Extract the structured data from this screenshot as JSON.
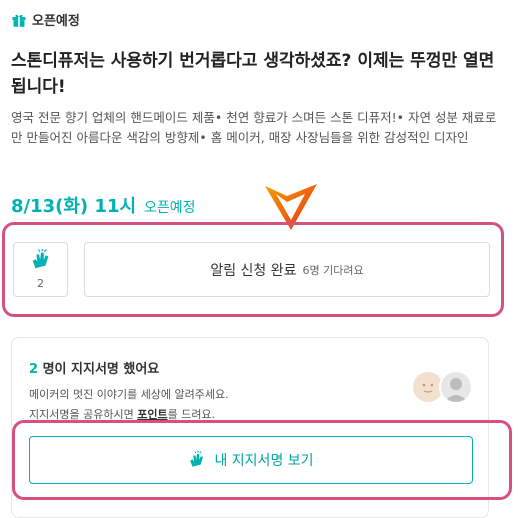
{
  "status": {
    "label": "오픈예정",
    "icon": "gift-icon"
  },
  "title": "스톤디퓨저는 사용하기 번거롭다고 생각하셨죠? 이제는 뚜껑만 열면 됩니다!",
  "description": "영국 전문 향기 업체의 핸드메이드 제품• 천연 향료가 스며든 스톤 디퓨저!• 자연 성분 재료로만 만들어진 아름다운 색감의 방향제• 홈 메이커, 매장 사장님들을 위한 감성적인 디자인",
  "open": {
    "date": "8/13(화) 11시",
    "tag": "오픈예정"
  },
  "like": {
    "count": "2",
    "icon": "clap-hands-icon"
  },
  "notify": {
    "label": "알림 신청 완료",
    "sub": "6명 기다려요"
  },
  "support": {
    "count": "2",
    "title_suffix": " 명이 지지서명 했어요",
    "line1": "메이커의 멋진 이야기를 세상에 알려주세요.",
    "line2_prefix": "지지서명을 공유하시면 ",
    "line2_point": "포인트",
    "line2_suffix": "를 드려요.",
    "button_label": "내 지지서명 보기",
    "button_icon": "clap-hands-icon"
  },
  "colors": {
    "accent": "#00b2b2",
    "highlight": "#d6527c",
    "arrow_orange": "#f5a000",
    "arrow_red": "#e8301c"
  }
}
